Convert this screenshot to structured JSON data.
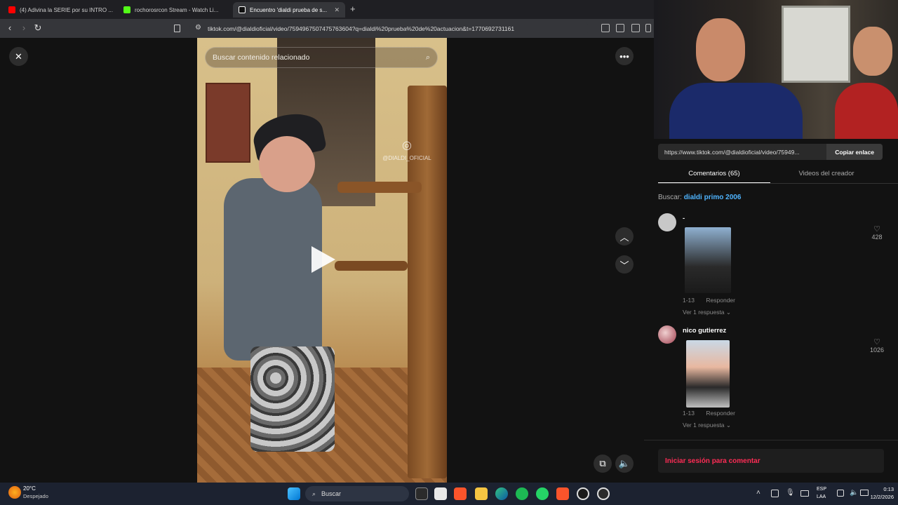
{
  "browser": {
    "tabs": [
      {
        "title": "(4) Adivina la SERIE por su INTRO ...",
        "color": "#ff0000"
      },
      {
        "title": "rochorosrcon Stream - Watch Li...",
        "color": "#53fc18"
      },
      {
        "title": "Encuentro 'dialdi prueba de s...",
        "color": "#ffffff"
      }
    ],
    "new_tab": "+",
    "url": "tiktok.com/@dialdioficial/video/7594967507475763604?q=dialdi%20prueba%20de%20actuacion&t=1770692731161"
  },
  "video": {
    "search_placeholder": "Buscar contenido relacionado",
    "watermark": "@DIALDI_OFICIAL",
    "close_icon": "close-icon",
    "more_icon": "more-icon"
  },
  "panel": {
    "share_link": "https://www.tiktok.com/@dialdioficial/video/75949...",
    "copy_label": "Copiar enlace",
    "tabs": [
      "Comentarios (65)",
      "Videos del creador"
    ],
    "search_prefix": "Buscar:",
    "search_query": "dialdi primo 2006",
    "comments": [
      {
        "name": "-",
        "date": "1-13",
        "reply": "Responder",
        "replies": "Ver 1 respuesta",
        "likes": "428"
      },
      {
        "name": "nico gutierrez",
        "date": "1-13",
        "reply": "Responder",
        "replies": "Ver 1 respuesta",
        "likes": "1026"
      }
    ],
    "login_prompt": "Iniciar sesión para comentar"
  },
  "taskbar": {
    "weather_temp": "20°C",
    "weather_desc": "Despejado",
    "search_label": "Buscar",
    "lang_top": "ESP",
    "lang_bottom": "LAA",
    "time": "0:13",
    "date": "12/2/2026"
  },
  "colors": {
    "accent_red": "#fe2c55",
    "link_blue": "#4fb4ff"
  }
}
